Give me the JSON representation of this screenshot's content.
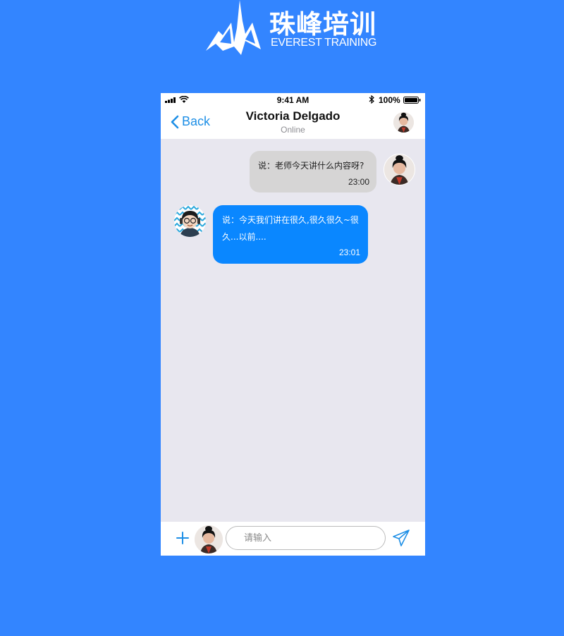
{
  "logo": {
    "chinese": "珠峰培训",
    "english": "EVEREST TRAINING"
  },
  "status_bar": {
    "time": "9:41 AM",
    "battery": "100%"
  },
  "nav": {
    "back_label": "Back",
    "title": "Victoria Delgado",
    "subtitle": "Online"
  },
  "messages": [
    {
      "direction": "outgoing",
      "text": "说：老师今天讲什么内容呀?",
      "time": "23:00"
    },
    {
      "direction": "incoming",
      "text": "说：今天我们讲在很久,很久很久~很久...以前....",
      "time": "23:01"
    }
  ],
  "composer": {
    "placeholder": "请输入",
    "value": ""
  },
  "colors": {
    "page_background": "#3385ff",
    "chat_background": "#e8e7ef",
    "incoming_bubble": "#0a87ff",
    "outgoing_bubble": "#d6d5d5",
    "accent": "#1e8fe6"
  }
}
